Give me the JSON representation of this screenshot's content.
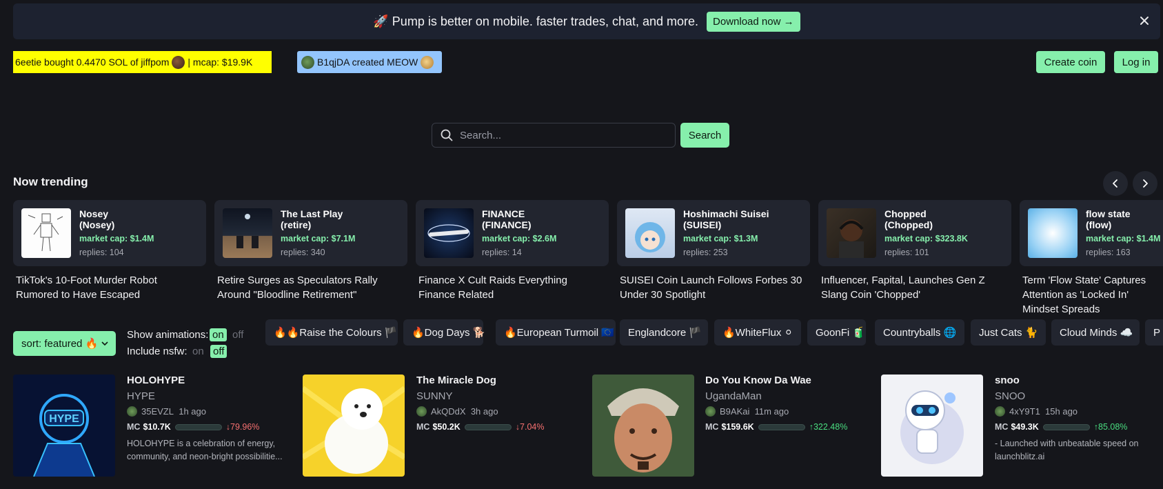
{
  "promo": {
    "text": "🚀 Pump is better on mobile. faster trades, chat, and more.",
    "button": "Download now →"
  },
  "ticker": {
    "buy_text": "6eetie bought 0.4470 SOL of jiffpom",
    "buy_mcap": "| mcap: $19.9K",
    "create_text": "B1qjDA created MEOW"
  },
  "header": {
    "create_coin": "Create coin",
    "log_in": "Log in"
  },
  "search": {
    "placeholder": "Search...",
    "button": "Search"
  },
  "trending": {
    "title": "Now trending",
    "cards": [
      {
        "name": "Nosey\n(Nosey)",
        "market_cap": "market cap: $1.4M",
        "replies": "replies: 104",
        "headline": "TikTok's 10-Foot Murder Robot Rumored to Have Escaped"
      },
      {
        "name": "The Last Play\n(retire)",
        "market_cap": "market cap: $7.1M",
        "replies": "replies: 340",
        "headline": "Retire Surges as Speculators Rally Around \"Bloodline Retirement\""
      },
      {
        "name": "FINANCE\n(FINANCE)",
        "market_cap": "market cap: $2.6M",
        "replies": "replies: 14",
        "headline": "Finance X Cult Raids Everything Finance Related"
      },
      {
        "name": "Hoshimachi Suisei\n(SUISEI)",
        "market_cap": "market cap: $1.3M",
        "replies": "replies: 253",
        "headline": "SUISEI Coin Launch Follows Forbes 30 Under 30 Spotlight"
      },
      {
        "name": "Chopped\n(Chopped)",
        "market_cap": "market cap: $323.8K",
        "replies": "replies: 101",
        "headline": "Influencer, Fapital, Launches Gen Z Slang Coin 'Chopped'"
      },
      {
        "name": "flow state\n(flow)",
        "market_cap": "market cap: $1.4M",
        "replies": "replies: 163",
        "headline": "Term 'Flow State' Captures Attention as 'Locked In' Mindset Spreads"
      }
    ]
  },
  "controls": {
    "sort": "sort: featured 🔥",
    "show_animations": "Show animations:",
    "include_nsfw": "Include nsfw:",
    "on": "on",
    "off": "off"
  },
  "chips": [
    "🔥🔥Raise the Colours 🏴",
    "🔥Dog Days 🐕",
    "🔥European Turmoil 🇪🇺",
    "Englandcore 🏴",
    "🔥WhiteFlux ⚪",
    "GoonFi 🧃",
    "Countryballs 🌐",
    "Just Cats 🐈",
    "Cloud Minds ☁️",
    "P"
  ],
  "coins": [
    {
      "name": "HOLOHYPE",
      "ticker": "HYPE",
      "creator": "35EVZL",
      "age": "1h ago",
      "mc_label": "MC",
      "mc": "$10.7K",
      "progress": 0.08,
      "change": "↓79.96%",
      "direction": "down",
      "description": "HOLOHYPE is a celebration of energy, community, and neon-bright possibilitie..."
    },
    {
      "name": "The Miracle Dog",
      "ticker": "SUNNY",
      "creator": "AkQDdX",
      "age": "3h ago",
      "mc_label": "MC",
      "mc": "$50.2K",
      "progress": 0.2,
      "change": "↓7.04%",
      "direction": "down",
      "description": ""
    },
    {
      "name": "Do You Know Da Wae",
      "ticker": "UgandaMan",
      "creator": "B9AKai",
      "age": "11m ago",
      "mc_label": "MC",
      "mc": "$159.6K",
      "progress": 0.6,
      "change": "↑322.48%",
      "direction": "up",
      "description": ""
    },
    {
      "name": "snoo",
      "ticker": "SNOO",
      "creator": "4xY9T1",
      "age": "15h ago",
      "mc_label": "MC",
      "mc": "$49.3K",
      "progress": 0.5,
      "change": "↑85.08%",
      "direction": "up",
      "description": "- Launched with unbeatable speed on launchblitz.ai"
    }
  ],
  "colors": {
    "accent": "#86efac",
    "ticker_yellow": "#ffff00",
    "ticker_blue": "#93c5fd",
    "up": "#4ade80",
    "down": "#f87171"
  }
}
